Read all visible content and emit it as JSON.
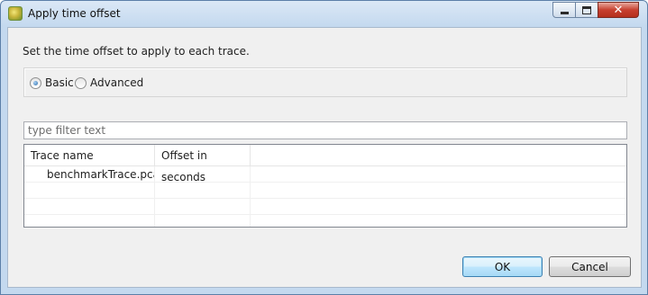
{
  "window": {
    "title": "Apply time offset",
    "icons": {
      "app": "eclipse-app-icon",
      "minimize": "minimize-icon",
      "maximize": "maximize-icon",
      "close": "close-icon"
    }
  },
  "dialog": {
    "description": "Set the time offset to apply to each trace.",
    "mode": {
      "options": [
        {
          "label": "Basic",
          "checked": true
        },
        {
          "label": "Advanced",
          "checked": false
        }
      ]
    },
    "filter": {
      "placeholder": "type filter text",
      "value": ""
    },
    "table": {
      "columns": [
        "Trace name",
        "Offset in seconds",
        ""
      ],
      "rows": [
        [
          "benchmarkTrace.pcap",
          "",
          ""
        ],
        [
          "",
          "",
          ""
        ],
        [
          "",
          "",
          ""
        ],
        [
          "",
          "",
          ""
        ]
      ]
    },
    "buttons": {
      "ok": "OK",
      "cancel": "Cancel"
    }
  }
}
